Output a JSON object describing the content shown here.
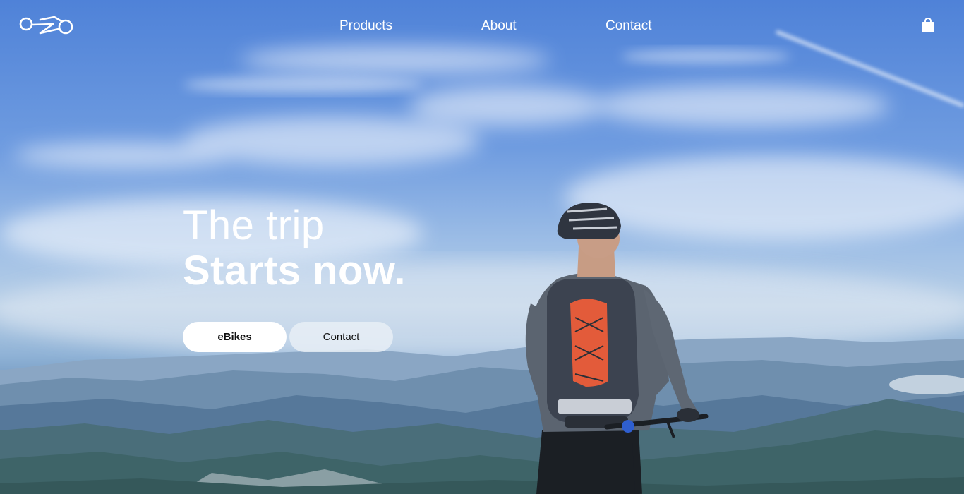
{
  "nav": {
    "links": [
      {
        "label": "Products"
      },
      {
        "label": "About"
      },
      {
        "label": "Contact"
      }
    ],
    "logo_icon": "bike-logo-icon",
    "cart_icon": "shopping-bag-icon"
  },
  "hero": {
    "headline_line1": "The trip",
    "headline_line2": "Starts now.",
    "primary_button": "eBikes",
    "secondary_button": "Contact"
  },
  "colors": {
    "text": "#ffffff",
    "sky": "#4f82d8",
    "button_primary_bg": "#ffffff",
    "button_secondary_bg": "#e8eef6"
  }
}
